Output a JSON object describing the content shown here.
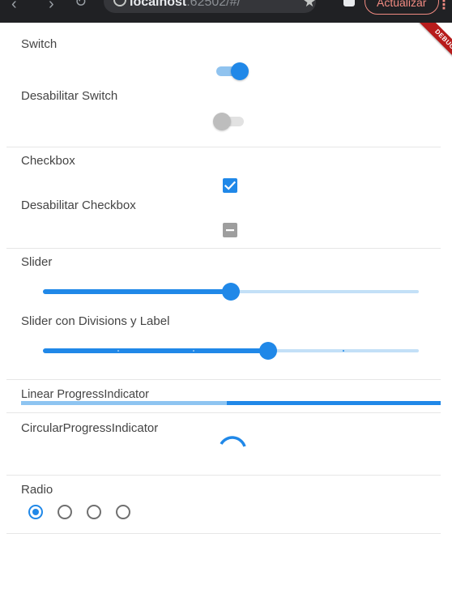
{
  "browser": {
    "address": "localhost",
    "address_suffix": ":62502/#/",
    "update_label": "Actualizar"
  },
  "debug_label": "DEBUG",
  "sections": {
    "switch": {
      "label": "Switch",
      "value": true
    },
    "switch_disabled": {
      "label": "Desabilitar Switch",
      "value": false
    },
    "checkbox": {
      "label": "Checkbox",
      "checked": true
    },
    "checkbox_disabled": {
      "label": "Desabilitar Checkbox",
      "state": "indeterminate"
    },
    "slider": {
      "label": "Slider",
      "value": 0.5
    },
    "slider_divisions": {
      "label": "Slider con Divisions y Label",
      "value": 0.6,
      "divisions": 5
    },
    "linear_progress": {
      "label": "Linear ProgressIndicator",
      "buffer_fraction": 0.49
    },
    "circular_progress": {
      "label": "CircularProgressIndicator"
    },
    "radio": {
      "label": "Radio",
      "options": 4,
      "selected_index": 0
    }
  },
  "colors": {
    "primary": "#2088e8",
    "primary_light": "#90c3ef",
    "disabled": "#bdbdbd",
    "debug_banner": "#b71c1c"
  }
}
